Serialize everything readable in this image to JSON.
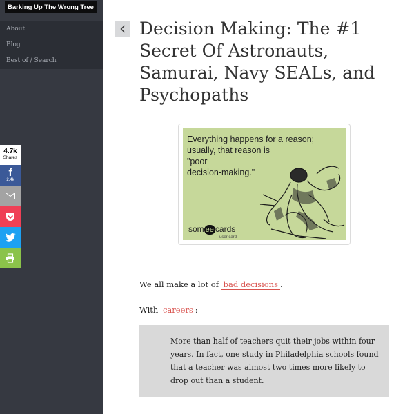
{
  "site": {
    "title": "Barking Up The Wrong Tree"
  },
  "nav": {
    "items": [
      {
        "label": "About"
      },
      {
        "label": "Blog"
      },
      {
        "label": "Best of / Search"
      }
    ]
  },
  "share": {
    "total_count": "4.7k",
    "total_label": "Shares",
    "facebook_count": "2.4k",
    "icons": [
      "facebook-icon",
      "mail-icon",
      "pocket-icon",
      "twitter-icon",
      "print-icon"
    ]
  },
  "article": {
    "title": "Decision Making: The #1 Secret Of Astronauts, Samurai, Navy SEALs, and Psychopaths",
    "ecard": {
      "text": "Everything happens for a reason;\nusually, that reason is\n\"poor\ndecision-making.\"",
      "logo_pre": "som",
      "logo_ee": "ee",
      "logo_post": "cards",
      "logo_sub": "user card"
    },
    "para1": {
      "before": "We all make a lot of ",
      "link": "bad decisions",
      "after": "."
    },
    "para2": {
      "before": "With ",
      "link": "careers",
      "after": ":"
    },
    "quote": "More than half of teachers quit their jobs within four years. In fact, one study in Philadelphia schools found that a teacher was almost two times more likely to drop out than a student."
  },
  "colors": {
    "sidebar": "#363941",
    "nav": "#2b2e35",
    "link": "#d9534f",
    "ecard": "#c6d89a",
    "quote_bg": "#d9d9d9"
  }
}
